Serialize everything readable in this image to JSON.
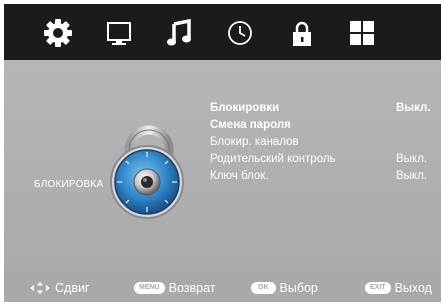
{
  "tabs": [
    {
      "name": "settings",
      "icon": "gear-icon",
      "active": true
    },
    {
      "name": "picture",
      "icon": "monitor-icon"
    },
    {
      "name": "sound",
      "icon": "music-note-icon"
    },
    {
      "name": "time",
      "icon": "clock-icon"
    },
    {
      "name": "lock",
      "icon": "padlock-icon"
    },
    {
      "name": "apps",
      "icon": "grid-icon"
    }
  ],
  "section_label": "БЛОКИРОВКА",
  "menu": [
    {
      "label": "Блокировки",
      "value": "Выкл.",
      "bold": true
    },
    {
      "label": "Смена пароля",
      "value": "",
      "bold": true
    },
    {
      "label": "Блокир. каналов",
      "value": ""
    },
    {
      "label": "Родительский контроль",
      "value": "Выкл."
    },
    {
      "label": "Ключ блок.",
      "value": "Выкл."
    }
  ],
  "footer": {
    "move_label": "Сдвиг",
    "menu_key": "MENU",
    "back_label": "Возврат",
    "ok_key": "OK",
    "select_label": "Выбор",
    "exit_key": "EXIT",
    "exit_label": "Выход"
  },
  "colors": {
    "topbar": "#1b1b1b",
    "background": "#b3b3b3",
    "lock_dial": "#2f86c6"
  }
}
